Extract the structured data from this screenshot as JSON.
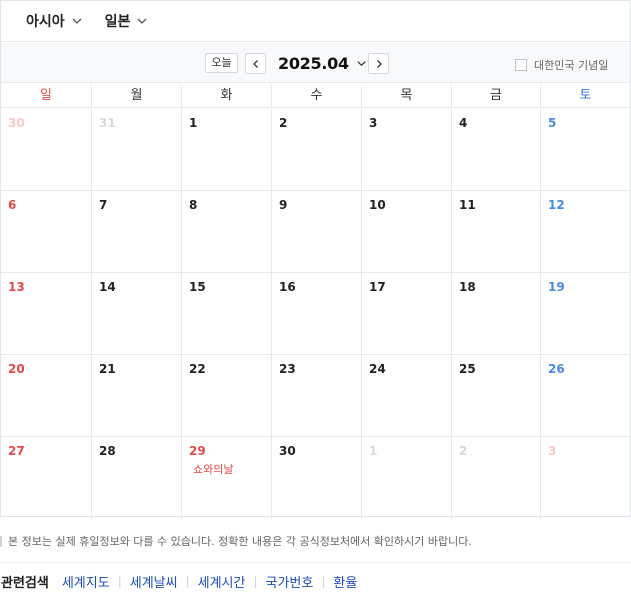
{
  "region": {
    "continent": "아시아",
    "country": "일본"
  },
  "nav": {
    "today_label": "오늘",
    "month_label": "2025.04",
    "holiday_toggle_label": "대한민국 기념일",
    "holiday_toggle_checked": false
  },
  "weekdays": [
    "일",
    "월",
    "화",
    "수",
    "목",
    "금",
    "토"
  ],
  "weeks": [
    [
      {
        "num": "30",
        "muted": true
      },
      {
        "num": "31",
        "muted": true
      },
      {
        "num": "1"
      },
      {
        "num": "2"
      },
      {
        "num": "3"
      },
      {
        "num": "4"
      },
      {
        "num": "5"
      }
    ],
    [
      {
        "num": "6"
      },
      {
        "num": "7"
      },
      {
        "num": "8"
      },
      {
        "num": "9"
      },
      {
        "num": "10"
      },
      {
        "num": "11"
      },
      {
        "num": "12"
      }
    ],
    [
      {
        "num": "13"
      },
      {
        "num": "14"
      },
      {
        "num": "15"
      },
      {
        "num": "16"
      },
      {
        "num": "17"
      },
      {
        "num": "18"
      },
      {
        "num": "19"
      }
    ],
    [
      {
        "num": "20"
      },
      {
        "num": "21"
      },
      {
        "num": "22"
      },
      {
        "num": "23"
      },
      {
        "num": "24"
      },
      {
        "num": "25"
      },
      {
        "num": "26"
      }
    ],
    [
      {
        "num": "27"
      },
      {
        "num": "28"
      },
      {
        "num": "29",
        "holiday": "쇼와의날"
      },
      {
        "num": "30"
      },
      {
        "num": "1",
        "muted": true
      },
      {
        "num": "2",
        "muted": true
      },
      {
        "num": "3",
        "muted": true
      }
    ]
  ],
  "notice": "본 정보는 실제 휴일정보와 다를 수 있습니다. 정확한 내용은 각 공식정보처에서 확인하시기 바랍니다.",
  "related": {
    "title": "관련검색",
    "links": [
      "세계지도",
      "세계날씨",
      "세계시간",
      "국가번호",
      "환율"
    ]
  },
  "colors": {
    "sunday": "#e34b4b",
    "saturday": "#4a8be0",
    "link": "#1a4db8",
    "muted": "#d8d8d8"
  }
}
